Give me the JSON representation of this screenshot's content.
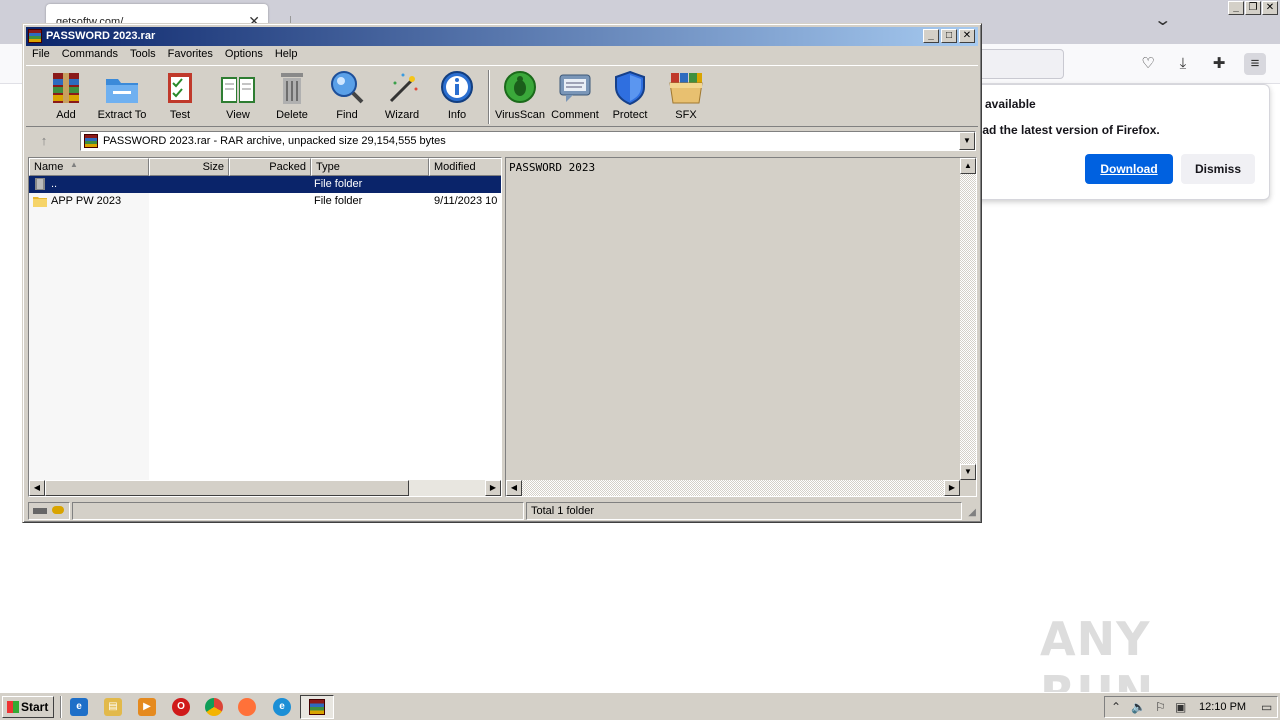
{
  "browser": {
    "tab_title": "getsoftw.com/",
    "notification": {
      "title": "e available",
      "message": "oad the latest version of Firefox.",
      "download_label": "Download",
      "dismiss_label": "Dismiss"
    }
  },
  "winrar": {
    "title": "PASSWORD 2023.rar",
    "menu": [
      "File",
      "Commands",
      "Tools",
      "Favorites",
      "Options",
      "Help"
    ],
    "toolbar": [
      "Add",
      "Extract To",
      "Test",
      "View",
      "Delete",
      "Find",
      "Wizard",
      "Info",
      "VirusScan",
      "Comment",
      "Protect",
      "SFX"
    ],
    "address": "PASSWORD 2023.rar - RAR archive, unpacked size 29,154,555 bytes",
    "columns": [
      "Name",
      "Size",
      "Packed",
      "Type",
      "Modified"
    ],
    "files": [
      {
        "name": "..",
        "type": "File folder",
        "modified": ""
      },
      {
        "name": "APP PW 2023",
        "type": "File folder",
        "modified": "9/11/2023 10"
      }
    ],
    "comment": "PASSWORD 2023",
    "status": "Total 1 folder"
  },
  "taskbar": {
    "start_label": "Start",
    "clock": "12:10 PM"
  },
  "watermark": "ANY RUN",
  "colors": {
    "title_gradient_start": "#0a246a",
    "selection": "#0a246a",
    "firefox_download": "#0061e0",
    "window_face": "#d4d0c8"
  }
}
